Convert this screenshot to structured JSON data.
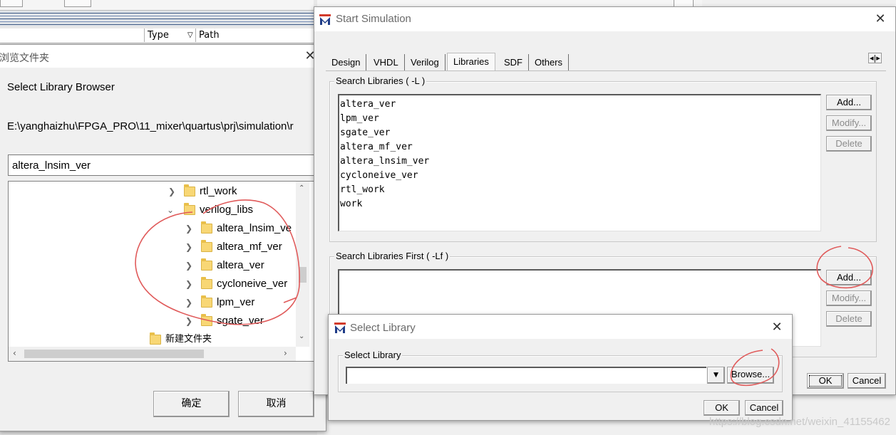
{
  "background": {
    "columns": {
      "type": "Type",
      "path": "Path"
    }
  },
  "browser": {
    "title": "浏览文件夹",
    "heading": "Select Library Browser",
    "path": "E:\\yanghaizhu\\FPGA_PRO\\11_mixer\\quartus\\prj\\simulation\\r",
    "selected_value": "altera_lnsim_ver",
    "tree": [
      {
        "label": "rtl_work",
        "expanded": false
      },
      {
        "label": "verilog_libs",
        "expanded": true
      },
      {
        "label": "altera_lnsim_ve",
        "expanded": false
      },
      {
        "label": "altera_mf_ver",
        "expanded": false
      },
      {
        "label": "altera_ver",
        "expanded": false
      },
      {
        "label": "cycloneive_ver",
        "expanded": false
      },
      {
        "label": "lpm_ver",
        "expanded": false
      },
      {
        "label": "sgate_ver",
        "expanded": false
      },
      {
        "label": "新建文件夹",
        "expanded": false
      }
    ],
    "ok_label": "确定",
    "cancel_label": "取消"
  },
  "start_sim": {
    "title": "Start Simulation",
    "tabs": [
      "Design",
      "VHDL",
      "Verilog",
      "Libraries",
      "SDF",
      "Others"
    ],
    "active_tab": "Libraries",
    "search_libraries_label": "Search Libraries ( -L )",
    "search_libraries": [
      "altera_ver",
      "lpm_ver",
      "sgate_ver",
      "altera_mf_ver",
      "altera_lnsim_ver",
      "cycloneive_ver",
      "rtl_work",
      "work"
    ],
    "search_first_label": "Search Libraries First ( -Lf )",
    "search_first": [],
    "add_label": "Add...",
    "modify_label": "Modify...",
    "delete_label": "Delete",
    "ok_label": "OK",
    "cancel_label": "Cancel"
  },
  "select_library": {
    "title": "Select Library",
    "group_label": "Select Library",
    "input_value": "",
    "browse_label": "Browse...",
    "ok_label": "OK",
    "cancel_label": "Cancel"
  },
  "watermark": "https://blog.csdn.net/weixin_41155462",
  "colors": {
    "annotation": "#e05a5a",
    "logo_blue": "#1f3c88",
    "logo_red": "#d23a2a"
  },
  "icons": [
    "modelsim-logo-icon",
    "close-icon",
    "folder-icon",
    "chevron-right-icon",
    "chevron-down-icon",
    "dropdown-arrow-icon"
  ]
}
